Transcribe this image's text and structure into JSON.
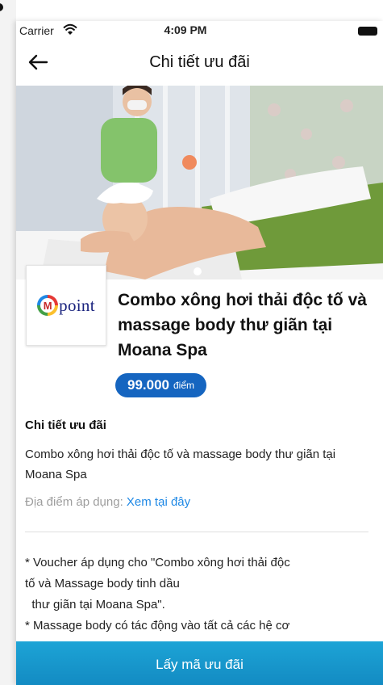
{
  "status_bar": {
    "carrier": "Carrier",
    "time": "4:09 PM"
  },
  "header": {
    "title": "Chi tiết ưu đãi"
  },
  "brand": {
    "logo_letter": "M",
    "logo_text": "point"
  },
  "offer": {
    "title": "Combo xông hơi thải độc tố và massage body thư giãn tại Moana Spa",
    "points_value": "99.000",
    "points_unit": "điểm"
  },
  "details": {
    "section_title": "Chi tiết ưu đãi",
    "description": "Combo xông hơi thải độc tố và massage body thư giãn tại Moana Spa",
    "location_label": "Địa điểm áp dụng:",
    "location_link": "Xem tại đây"
  },
  "notes": [
    " * Voucher áp dụng cho \"Combo xông hơi thải độc",
    "tố và Massage body tinh dầu",
    "  thư giãn tại Moana Spa\".",
    " * Massage body có tác động vào tất cả các hệ cơ"
  ],
  "cta": {
    "label": "Lấy mã ưu đãi"
  },
  "colors": {
    "accent": "#1289c1",
    "badge": "#1565c0",
    "link": "#1e88e5"
  },
  "icons": [
    "wifi-icon",
    "battery-icon",
    "back-arrow-icon",
    "mpoint-logo"
  ]
}
